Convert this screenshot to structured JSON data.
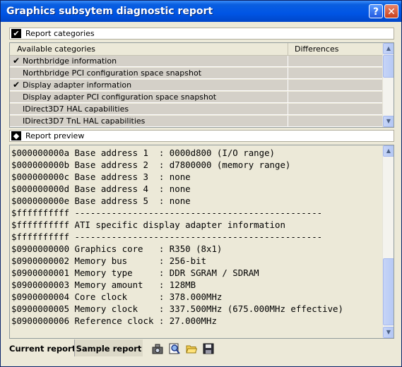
{
  "window": {
    "title": "Graphics subsytem diagnostic report",
    "help_glyph": "?",
    "close_glyph": "✕"
  },
  "categories_bar": {
    "label": "Report categories",
    "checkbox_glyph": "✔"
  },
  "categories": {
    "col_available": "Available categories",
    "col_differences": "Differences",
    "items": [
      {
        "label": "Northbridge information",
        "checked": true
      },
      {
        "label": "Northbridge PCI configuration space snapshot",
        "checked": false
      },
      {
        "label": "Display adapter information",
        "checked": true
      },
      {
        "label": "Display adapter PCI configuration space snapshot",
        "checked": false
      },
      {
        "label": "IDirect3D7 HAL capabilities",
        "checked": false
      },
      {
        "label": "IDirect3D7 TnL HAL capabilities",
        "checked": false
      }
    ],
    "check_glyph": "✔"
  },
  "preview_bar": {
    "label": "Report preview",
    "icon_glyph": "◆"
  },
  "preview": {
    "lines": [
      "$000000000a Base address 1  : 0000d800 (I/O range)",
      "$000000000b Base address 2  : d7800000 (memory range)",
      "$000000000c Base address 3  : none",
      "$000000000d Base address 4  : none",
      "$000000000e Base address 5  : none",
      "$ffffffffff -----------------------------------------------",
      "$ffffffffff ATI specific display adapter information",
      "$ffffffffff -----------------------------------------------",
      "$0900000000 Graphics core   : R350 (8x1)",
      "$0900000002 Memory bus      : 256-bit",
      "$0900000001 Memory type     : DDR SGRAM / SDRAM",
      "$0900000003 Memory amount   : 128MB",
      "$0900000004 Core clock      : 378.000MHz",
      "$0900000005 Memory clock    : 337.500MHz (675.000MHz effective)",
      "$0900000006 Reference clock : 27.000MHz"
    ]
  },
  "tabs": {
    "current": "Current report",
    "sample": "Sample report"
  },
  "toolbar": {
    "icons": [
      "camera-icon",
      "preview-zoom-icon",
      "open-folder-icon",
      "save-disk-icon"
    ]
  },
  "colors": {
    "title_blue": "#0055e5",
    "row_gray": "#d4d0c8",
    "panel": "#ece9d8"
  }
}
